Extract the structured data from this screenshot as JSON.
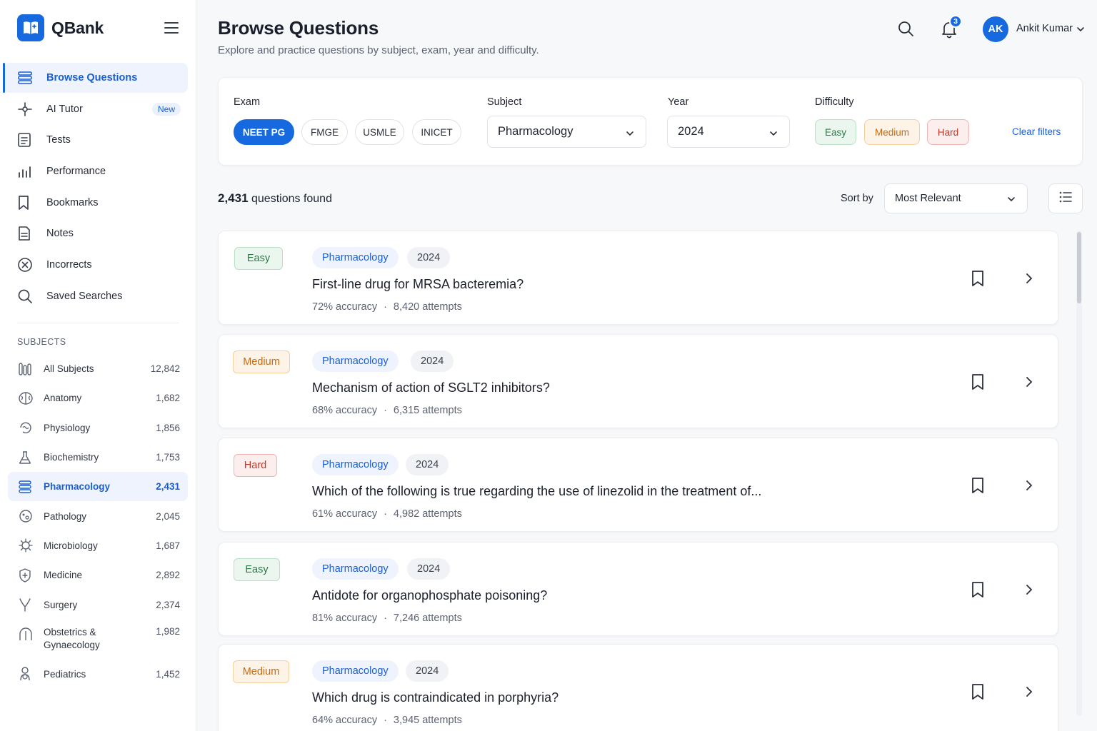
{
  "brand": {
    "name": "QBank"
  },
  "nav": [
    {
      "label": "Browse Questions",
      "icon": "list-icon",
      "active": true
    },
    {
      "label": "AI Tutor",
      "icon": "sparkle-icon",
      "badge": "New"
    },
    {
      "label": "Tests",
      "icon": "document-icon"
    },
    {
      "label": "Performance",
      "icon": "bar-chart-icon"
    },
    {
      "label": "Bookmarks",
      "icon": "bookmark-icon"
    },
    {
      "label": "Notes",
      "icon": "note-icon"
    },
    {
      "label": "Incorrects",
      "icon": "x-circle-icon"
    },
    {
      "label": "Saved Searches",
      "icon": "search-icon"
    }
  ],
  "subjects_header": "SUBJECTS",
  "subjects": [
    {
      "label": "All Subjects",
      "count": "12,842",
      "icon": "test-tubes-icon"
    },
    {
      "label": "Anatomy",
      "count": "1,682",
      "icon": "brain-icon"
    },
    {
      "label": "Physiology",
      "count": "1,856",
      "icon": "physiology-icon"
    },
    {
      "label": "Biochemistry",
      "count": "1,753",
      "icon": "flask-icon"
    },
    {
      "label": "Pharmacology",
      "count": "2,431",
      "icon": "pills-icon",
      "active": true
    },
    {
      "label": "Pathology",
      "count": "2,045",
      "icon": "pathology-icon"
    },
    {
      "label": "Microbiology",
      "count": "1,687",
      "icon": "microbe-icon"
    },
    {
      "label": "Medicine",
      "count": "2,892",
      "icon": "medical-shield-icon"
    },
    {
      "label": "Surgery",
      "count": "2,374",
      "icon": "scalpel-icon"
    },
    {
      "label": "Obstetrics & Gynaecology",
      "count": "1,982",
      "icon": "pregnancy-icon"
    },
    {
      "label": "Pediatrics",
      "count": "1,452",
      "icon": "child-icon"
    }
  ],
  "header": {
    "title": "Browse Questions",
    "subtitle": "Explore and practice questions by subject, exam, year and difficulty.",
    "notifications": "3",
    "user_initials": "AK",
    "user_name": "Ankit Kumar"
  },
  "filters": {
    "exam_label": "Exam",
    "exams": [
      "NEET PG",
      "FMGE",
      "USMLE",
      "INICET"
    ],
    "exam_selected": "NEET PG",
    "subject_label": "Subject",
    "subject_value": "Pharmacology",
    "year_label": "Year",
    "year_value": "2024",
    "difficulty_label": "Difficulty",
    "difficulties": [
      "Easy",
      "Medium",
      "Hard"
    ],
    "clear_label": "Clear filters"
  },
  "results": {
    "count": "2,431",
    "count_suffix": "questions found",
    "sort_label": "Sort by",
    "sort_value": "Most Relevant"
  },
  "questions": [
    {
      "difficulty": "Easy",
      "subject": "Pharmacology",
      "year": "2024",
      "title": "First-line drug for MRSA bacteremia?",
      "accuracy": "72% accuracy",
      "attempts": "8,420 attempts"
    },
    {
      "difficulty": "Medium",
      "subject": "Pharmacology",
      "year": "2024",
      "title": "Mechanism of action of SGLT2 inhibitors?",
      "accuracy": "68% accuracy",
      "attempts": "6,315 attempts"
    },
    {
      "difficulty": "Hard",
      "subject": "Pharmacology",
      "year": "2024",
      "title": "Which of the following is true regarding the use of linezolid in the treatment of...",
      "accuracy": "61% accuracy",
      "attempts": "4,982 attempts"
    },
    {
      "difficulty": "Easy",
      "subject": "Pharmacology",
      "year": "2024",
      "title": "Antidote for organophosphate poisoning?",
      "accuracy": "81% accuracy",
      "attempts": "7,246 attempts"
    },
    {
      "difficulty": "Medium",
      "subject": "Pharmacology",
      "year": "2024",
      "title": "Which drug is contraindicated in porphyria?",
      "accuracy": "64% accuracy",
      "attempts": "3,945 attempts"
    }
  ],
  "colors": {
    "accent": "#1769e0",
    "easy": "#2a7a45",
    "medium": "#c76a10",
    "hard": "#c0392b"
  }
}
